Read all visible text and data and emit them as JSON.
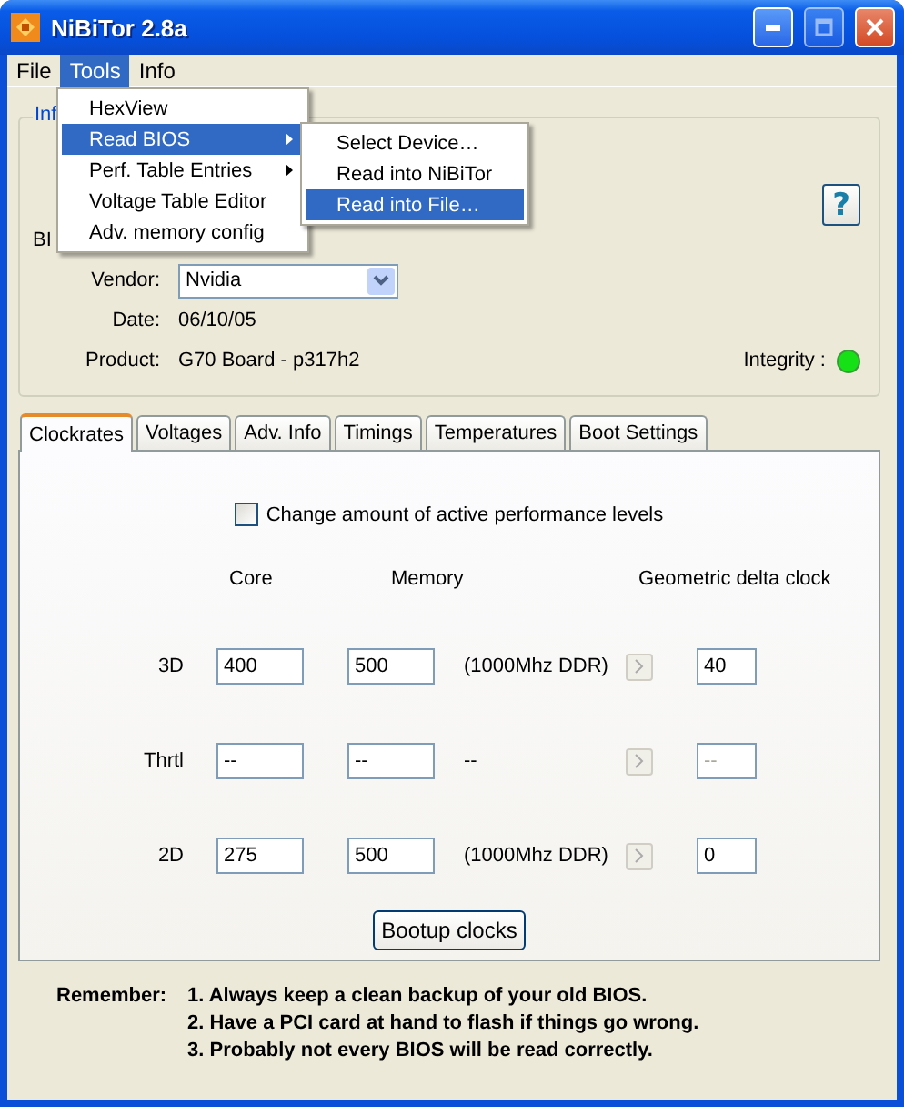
{
  "window": {
    "title": "NiBiTor 2.8a"
  },
  "menu_bar": [
    {
      "label": "File",
      "selected": false
    },
    {
      "label": "Tools",
      "selected": true
    },
    {
      "label": "Info",
      "selected": false
    }
  ],
  "tools_menu": [
    {
      "label": "HexView",
      "selected": false,
      "has_submenu": false
    },
    {
      "label": "Read BIOS",
      "selected": true,
      "has_submenu": true
    },
    {
      "label": "Perf. Table Entries",
      "selected": false,
      "has_submenu": true
    },
    {
      "label": "Voltage Table Editor",
      "selected": false,
      "has_submenu": false
    },
    {
      "label": "Adv. memory config",
      "selected": false,
      "has_submenu": false
    }
  ],
  "read_bios_submenu": [
    {
      "label": "Select Device…",
      "selected": false
    },
    {
      "label": "Read into NiBiTor",
      "selected": false
    },
    {
      "label": "Read into File…",
      "selected": true
    }
  ],
  "info_group": {
    "title": "Inf",
    "bios_label": "BI",
    "help_button": "?",
    "vendor": {
      "label": "Vendor:",
      "value": "Nvidia"
    },
    "date": {
      "label": "Date:",
      "value": "06/10/05"
    },
    "product": {
      "label": "Product:",
      "value": "G70 Board - p317h2"
    },
    "integrity": {
      "label": "Integrity :",
      "ok": true
    }
  },
  "tabs": [
    {
      "label": "Clockrates",
      "selected": true
    },
    {
      "label": "Voltages",
      "selected": false
    },
    {
      "label": "Adv. Info",
      "selected": false
    },
    {
      "label": "Timings",
      "selected": false
    },
    {
      "label": "Temperatures",
      "selected": false
    },
    {
      "label": "Boot Settings",
      "selected": false
    }
  ],
  "clockrates": {
    "checkbox": {
      "label": "Change amount of active performance levels",
      "checked": false
    },
    "columns": [
      "Core",
      "Memory",
      "Geometric delta clock"
    ],
    "rows": [
      {
        "label": "3D",
        "core": "400",
        "memory": "500",
        "note": "(1000Mhz DDR)",
        "delta": "40",
        "disabled": false
      },
      {
        "label": "Thrtl",
        "core": "--",
        "memory": "--",
        "note": "--",
        "delta": "--",
        "disabled": true
      },
      {
        "label": "2D",
        "core": "275",
        "memory": "500",
        "note": "(1000Mhz DDR)",
        "delta": "0",
        "disabled": false
      }
    ],
    "bootup_button": "Bootup clocks"
  },
  "notes": {
    "label": "Remember:",
    "items": [
      "1. Always keep a clean backup of your old BIOS.",
      "2. Have a PCI card at hand to flash if things go wrong.",
      "3. Probably not every BIOS will be read correctly."
    ]
  }
}
